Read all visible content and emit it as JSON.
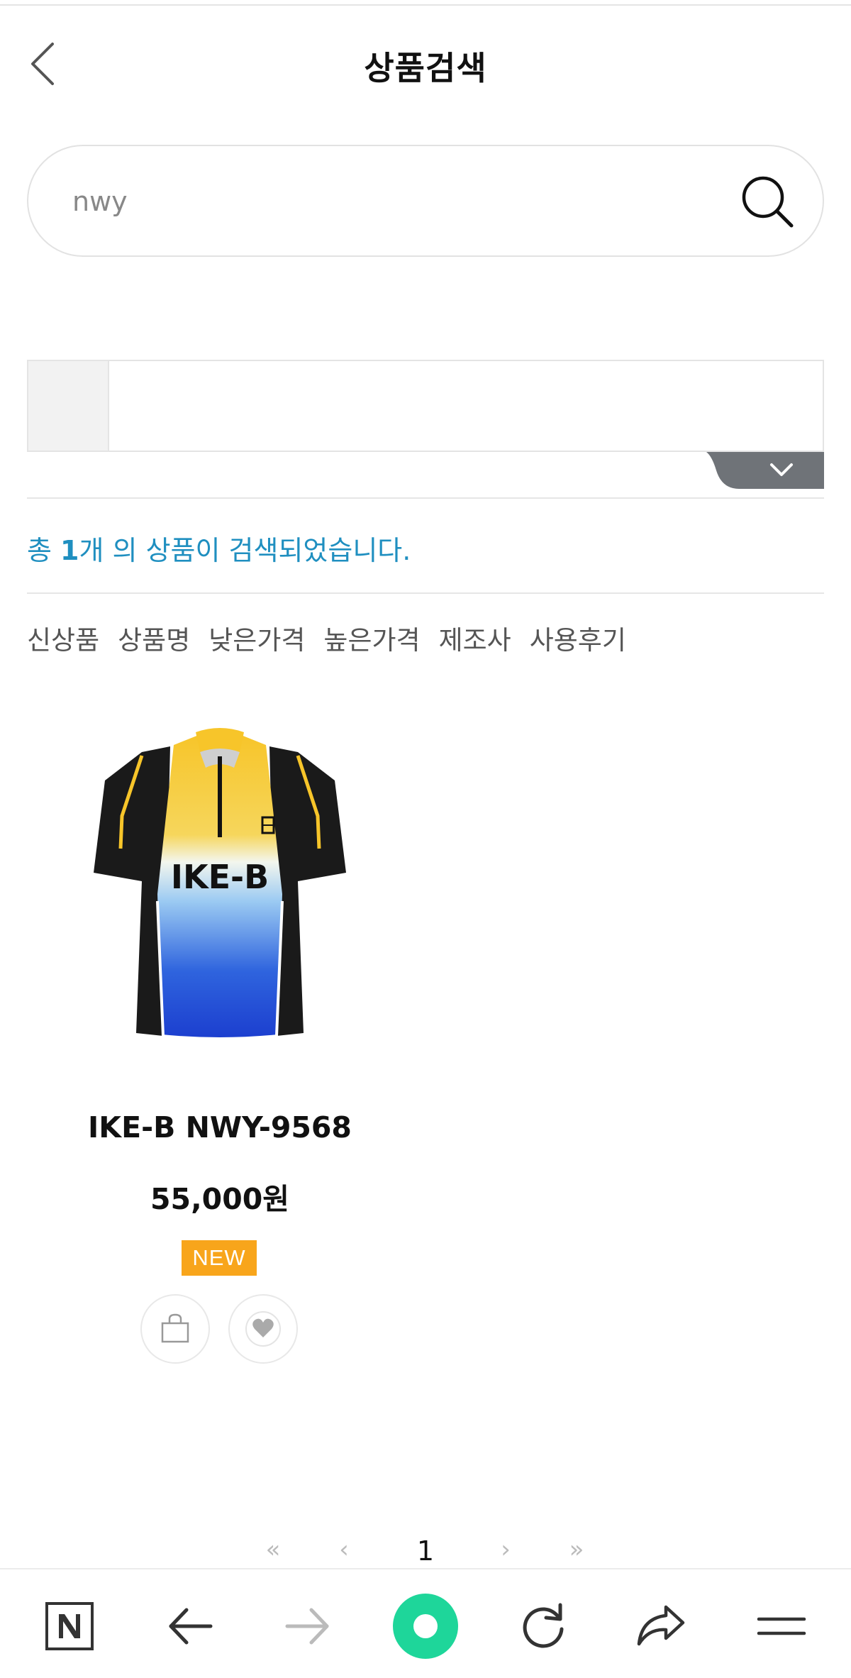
{
  "header": {
    "title": "상품검색"
  },
  "search": {
    "value": "nwy"
  },
  "results": {
    "prefix": "총 ",
    "count": "1",
    "suffix": "개 의 상품이 검색되었습니다."
  },
  "sort_tabs": [
    "신상품",
    "상품명",
    "낮은가격",
    "높은가격",
    "제조사",
    "사용후기"
  ],
  "product": {
    "name": "IKE-B NWY-9568",
    "price": "55,000원",
    "badge": "NEW",
    "image_text": "IKE-B",
    "badge_color": "#f8a51b"
  },
  "pagination": {
    "first": "«",
    "prev": "‹",
    "current": "1",
    "next": "›",
    "last": "»"
  },
  "colors": {
    "accent": "#1f8fc0",
    "browser_green": "#1ed69a"
  }
}
